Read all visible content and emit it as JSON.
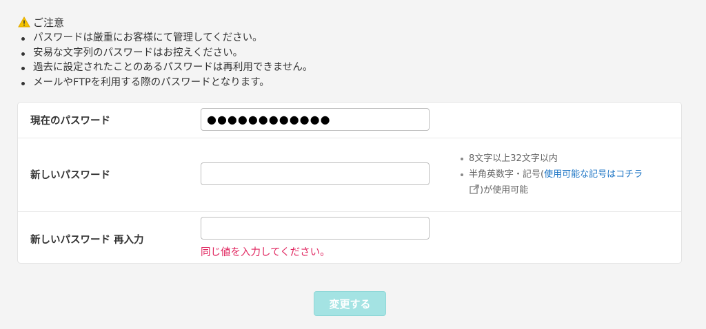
{
  "notice": {
    "title": "ご注意",
    "items": [
      "パスワードは厳重にお客様にて管理してください。",
      "安易な文字列のパスワードはお控えください。",
      "過去に設定されたことのあるパスワードは再利用できません。",
      "メールやFTPを利用する際のパスワードとなります。"
    ]
  },
  "form": {
    "current_password": {
      "label": "現在のパスワード",
      "value": "●●●●●●●●●●●●"
    },
    "new_password": {
      "label": "新しいパスワード",
      "value": "",
      "hints": {
        "length": "8文字以上32文字以内",
        "chars_prefix": "半角英数字・記号(",
        "chars_link": "使用可能な記号はコチラ",
        "chars_suffix": ")が使用可能"
      }
    },
    "confirm_password": {
      "label": "新しいパスワード 再入力",
      "value": "",
      "error": "同じ値を入力してください。"
    },
    "submit_label": "変更する"
  },
  "colors": {
    "background": "#f4f4f4",
    "link": "#1a73c4",
    "error": "#e0245e",
    "button_disabled": "#a4e3e3",
    "warning": "#f5c400"
  },
  "icons": {
    "warning": "warning-triangle-icon",
    "external_link": "external-link-icon"
  }
}
